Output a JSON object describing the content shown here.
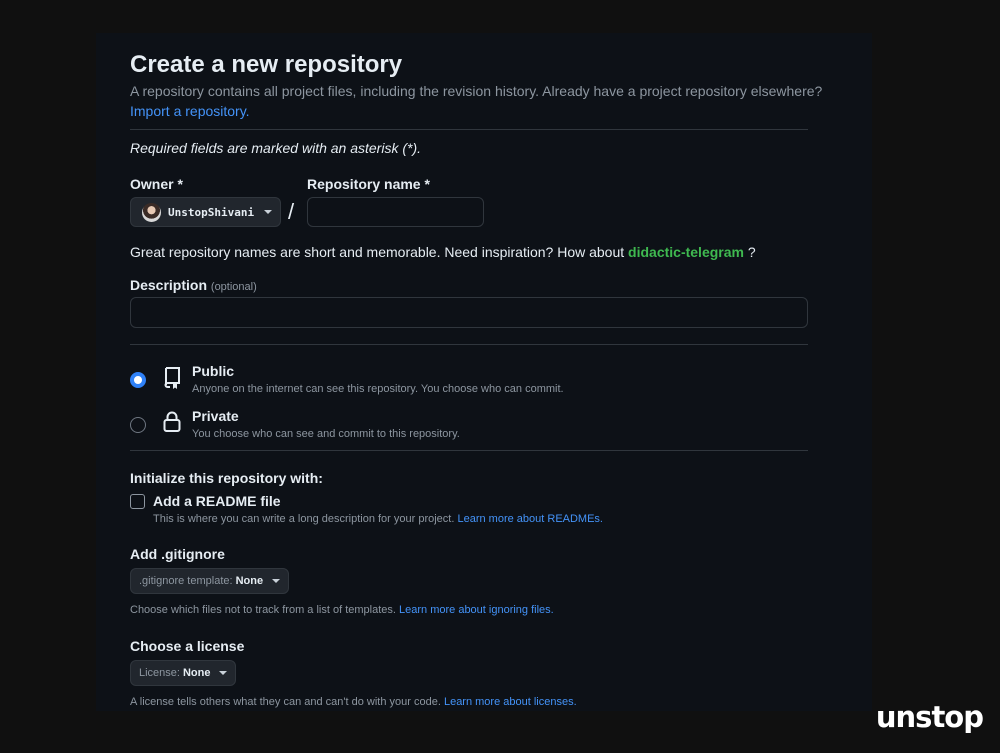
{
  "header": {
    "title": "Create a new repository",
    "subtitle": "A repository contains all project files, including the revision history. Already have a project repository elsewhere?",
    "import_link": "Import a repository."
  },
  "required_note": "Required fields are marked with an asterisk (*).",
  "owner": {
    "label": "Owner *",
    "value": "UnstopShivani"
  },
  "repo_name": {
    "label": "Repository name *",
    "value": "",
    "separator": "/"
  },
  "inspiration": {
    "text": "Great repository names are short and memorable. Need inspiration? How about",
    "suggestion": "didactic-telegram",
    "suffix": "?"
  },
  "description": {
    "label": "Description",
    "optional": "(optional)",
    "value": ""
  },
  "visibility": {
    "public": {
      "title": "Public",
      "desc": "Anyone on the internet can see this repository. You choose who can commit.",
      "selected": true,
      "icon": "repo-icon"
    },
    "private": {
      "title": "Private",
      "desc": "You choose who can see and commit to this repository.",
      "selected": false,
      "icon": "lock-icon"
    }
  },
  "initialize": {
    "heading": "Initialize this repository with:",
    "readme_label": "Add a README file",
    "readme_desc": "This is where you can write a long description for your project.",
    "readme_link": "Learn more about READMEs.",
    "readme_checked": false
  },
  "gitignore": {
    "heading": "Add .gitignore",
    "prefix": ".gitignore template:",
    "value": "None",
    "desc": "Choose which files not to track from a list of templates.",
    "link": "Learn more about ignoring files."
  },
  "license": {
    "heading": "Choose a license",
    "prefix": "License:",
    "value": "None",
    "desc": "A license tells others what they can and can't do with your code.",
    "link": "Learn more about licenses."
  },
  "watermark": {
    "text": "unstop"
  },
  "colors": {
    "accent": "#2f81f7",
    "link": "#4493f8",
    "suggestion": "#3fb950",
    "panel_bg": "#0d1117",
    "page_bg": "#101010"
  }
}
